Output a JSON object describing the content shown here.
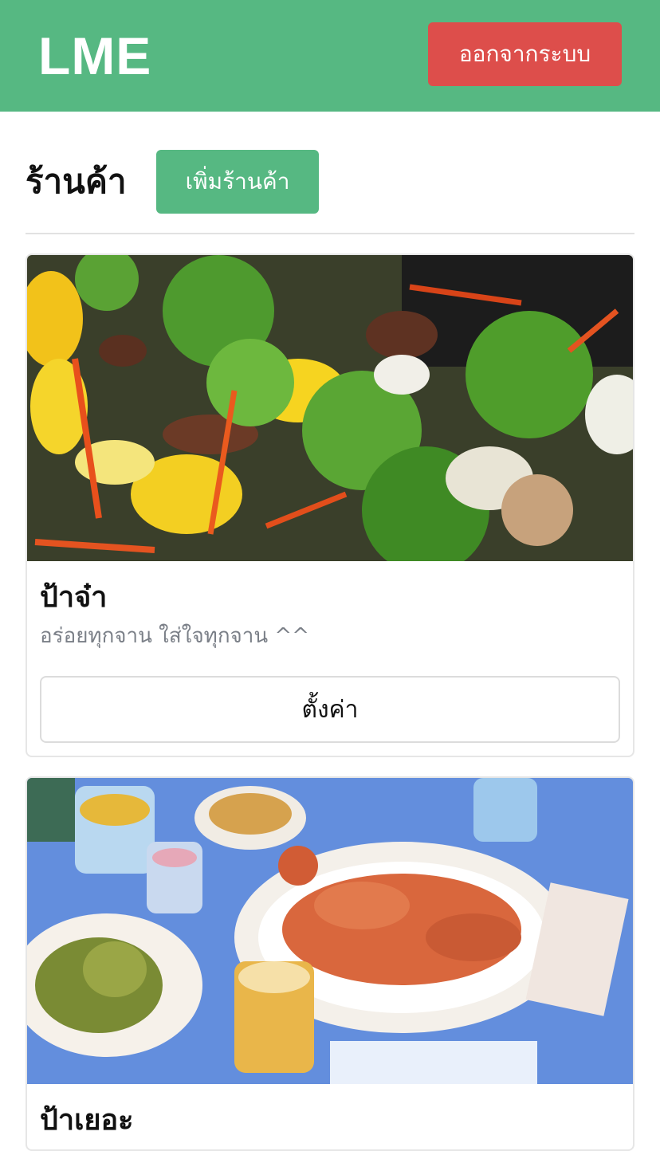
{
  "navbar": {
    "brand": "LME",
    "logout_label": "ออกจากระบบ",
    "color": "#56b882",
    "logout_color": "#dd4e4b"
  },
  "main": {
    "title": "ร้านค้า",
    "add_shop_label": "เพิ่มร้านค้า"
  },
  "shops": [
    {
      "name": "ป้าจ๋า",
      "description": "อร่อยทุกจาน ใส่ใจทุกจาน ^^",
      "settings_label": "ตั้งค่า"
    },
    {
      "name": "ป้าเยอะ"
    }
  ]
}
